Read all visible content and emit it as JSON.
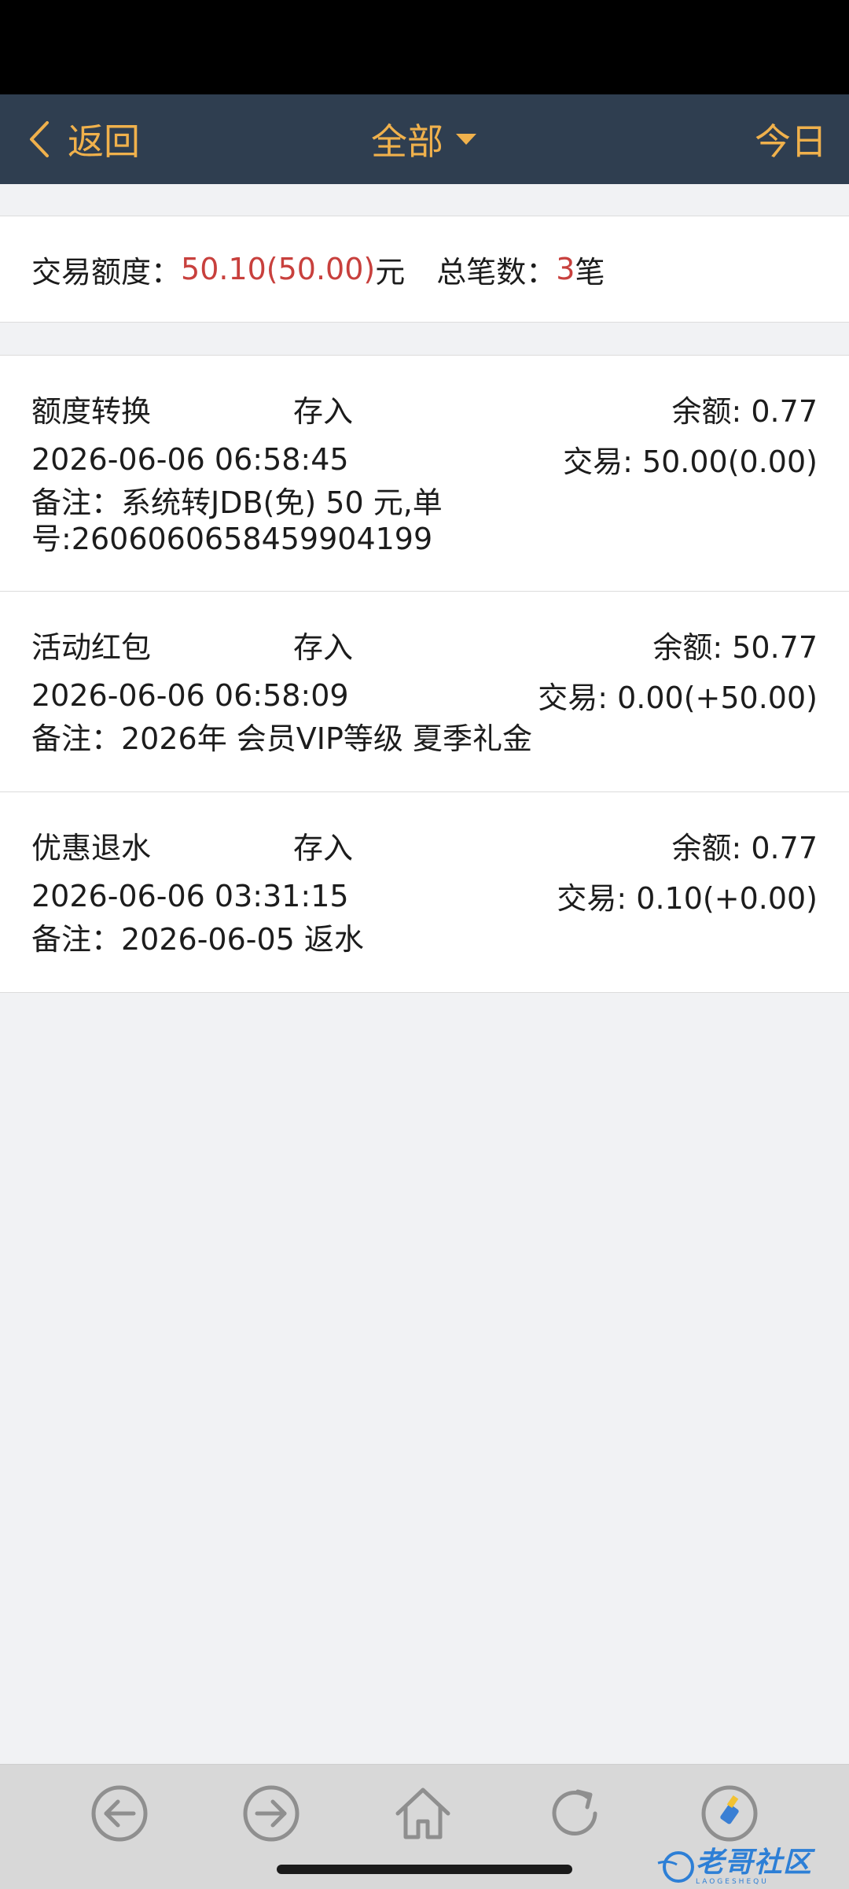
{
  "header": {
    "back_label": "返回",
    "title": "全部",
    "today_label": "今日",
    "bg_color": "#2f3e50",
    "accent_color": "#f0b14c"
  },
  "summary": {
    "amount_label": "交易额度：",
    "amount_value": "50.10(50.00)",
    "amount_unit": "元",
    "count_label": "总笔数：",
    "count_value": "3",
    "count_unit": "笔",
    "highlight_color": "#c8403d"
  },
  "records": [
    {
      "type": "额度转换",
      "direction": "存入",
      "balance": "余额: 0.77",
      "datetime": "2026-06-06 06:58:45",
      "transaction": "交易: 50.00(0.00)",
      "note": "备注：系统转JDB(免) 50 元,单号:2606060658459904199"
    },
    {
      "type": "活动红包",
      "direction": "存入",
      "balance": "余额: 50.77",
      "datetime": "2026-06-06 06:58:09",
      "transaction": "交易: 0.00(+50.00)",
      "note": "备注：2026年 会员VIP等级 夏季礼金"
    },
    {
      "type": "优惠退水",
      "direction": "存入",
      "balance": "余额: 0.77",
      "datetime": "2026-06-06 03:31:15",
      "transaction": "交易: 0.10(+0.00)",
      "note": "备注：2026-06-05 返水"
    }
  ],
  "bottom_nav": {
    "icons": [
      "back-arrow-icon",
      "forward-arrow-icon",
      "home-icon",
      "refresh-icon",
      "clear-cache-icon"
    ]
  },
  "watermark": {
    "text": "老哥社区",
    "subtext": "LAOGESHEQU"
  }
}
